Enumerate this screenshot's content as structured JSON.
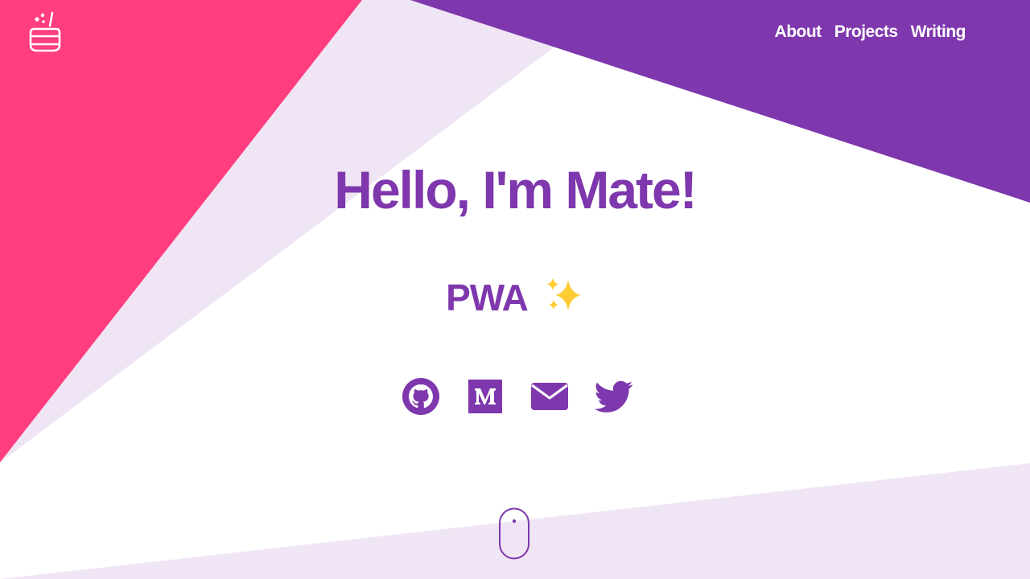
{
  "colors": {
    "purple": "#7e37ad",
    "pink": "#ff3d7f",
    "lavender": "#efe5f5",
    "white": "#ffffff"
  },
  "header": {
    "logo_icon": "cauldron-icon",
    "nav": [
      {
        "label": "About"
      },
      {
        "label": "Projects"
      },
      {
        "label": "Writing"
      }
    ]
  },
  "hero": {
    "title": "Hello, I'm Mate!",
    "subtitle": "PWA",
    "subtitle_icon": "sparkles-icon"
  },
  "socials": [
    {
      "icon": "github-icon"
    },
    {
      "icon": "medium-icon"
    },
    {
      "icon": "email-icon"
    },
    {
      "icon": "twitter-icon"
    }
  ],
  "scroll_indicator": {
    "icon": "mouse-scroll-icon"
  }
}
